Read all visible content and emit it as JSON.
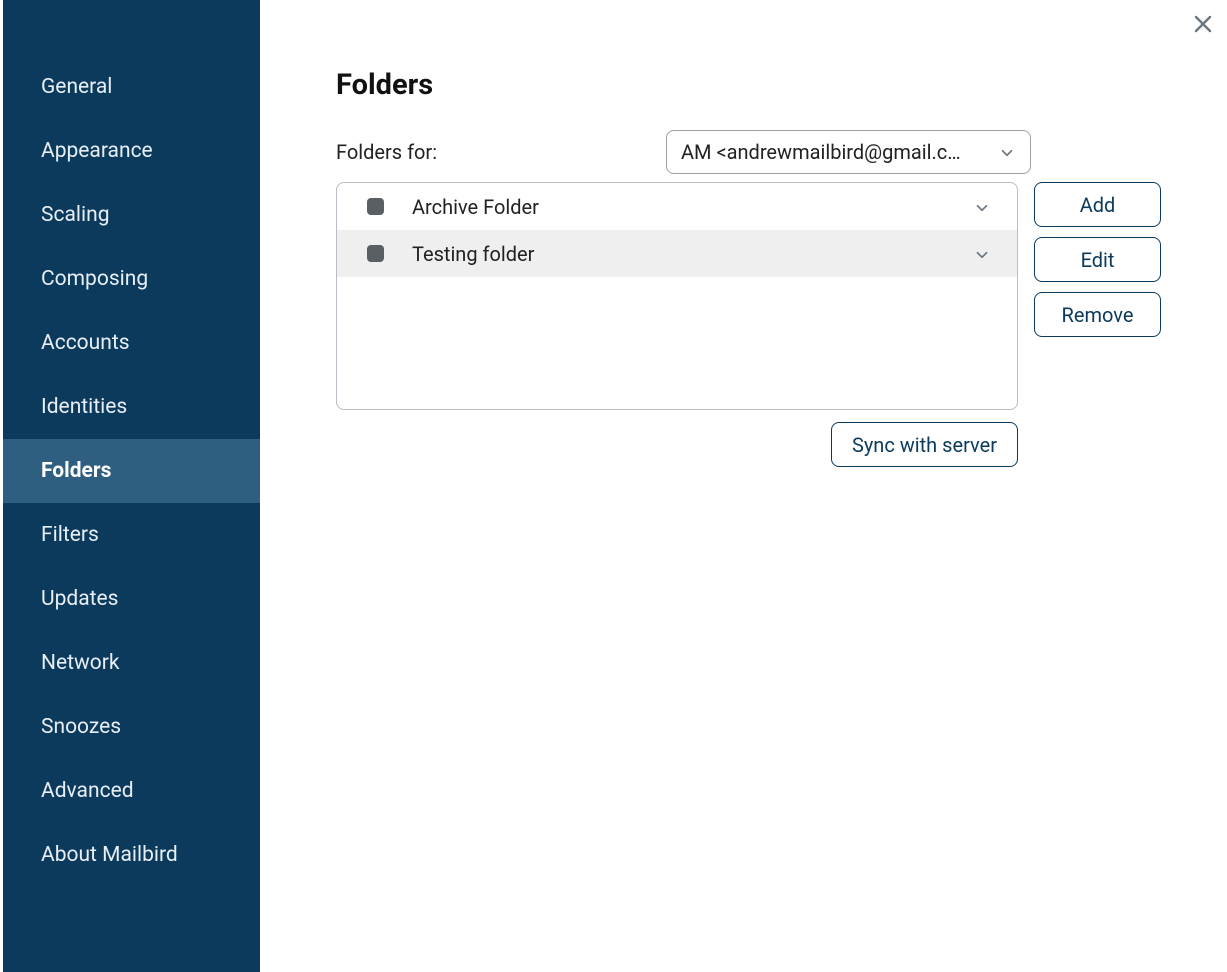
{
  "sidebar": {
    "items": [
      {
        "label": "General",
        "active": false
      },
      {
        "label": "Appearance",
        "active": false
      },
      {
        "label": "Scaling",
        "active": false
      },
      {
        "label": "Composing",
        "active": false
      },
      {
        "label": "Accounts",
        "active": false
      },
      {
        "label": "Identities",
        "active": false
      },
      {
        "label": "Folders",
        "active": true
      },
      {
        "label": "Filters",
        "active": false
      },
      {
        "label": "Updates",
        "active": false
      },
      {
        "label": "Network",
        "active": false
      },
      {
        "label": "Snoozes",
        "active": false
      },
      {
        "label": "Advanced",
        "active": false
      },
      {
        "label": "About Mailbird",
        "active": false
      }
    ]
  },
  "main": {
    "title": "Folders",
    "folders_for_label": "Folders for:",
    "account_selected": "AM <andrewmailbird@gmail.c…",
    "folders": [
      {
        "label": "Archive Folder",
        "selected": false
      },
      {
        "label": "Testing folder",
        "selected": true
      }
    ],
    "buttons": {
      "add": "Add",
      "edit": "Edit",
      "remove": "Remove",
      "sync": "Sync with server"
    }
  }
}
